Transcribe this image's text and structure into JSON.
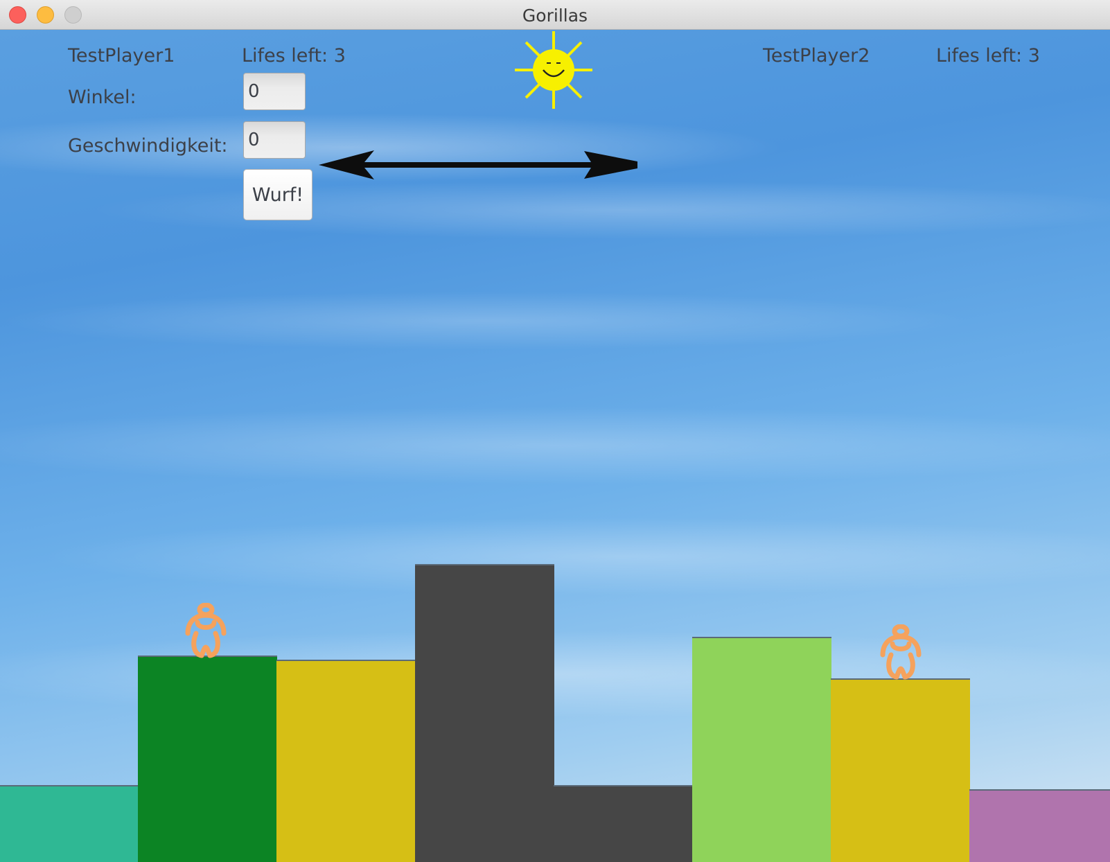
{
  "window": {
    "title": "Gorillas",
    "buttons": [
      "close",
      "minimize",
      "zoom"
    ]
  },
  "player1": {
    "name": "TestPlayer1",
    "lives_label": "Lifes left: 3",
    "angle_label": "Winkel:",
    "angle_value": "0",
    "speed_label": "Geschwindigkeit:",
    "speed_value": "0",
    "throw_label": "Wurf!"
  },
  "player2": {
    "name": "TestPlayer2",
    "lives_label": "Lifes left: 3"
  },
  "wind": {
    "direction": "left",
    "icon": "arrow-left-icon"
  },
  "sun": {
    "icon": "smiling-sun-icon",
    "color": "#f7f000"
  },
  "gorilla_color": "#f5a25d",
  "buildings": [
    {
      "color": "#2fb894"
    },
    {
      "color": "#0c8424"
    },
    {
      "color": "#d6bf15"
    },
    {
      "color": "#464646"
    },
    {
      "color": "#464646"
    },
    {
      "color": "#8fd35a"
    },
    {
      "color": "#d6bf15"
    },
    {
      "color": "#b074ad"
    }
  ]
}
